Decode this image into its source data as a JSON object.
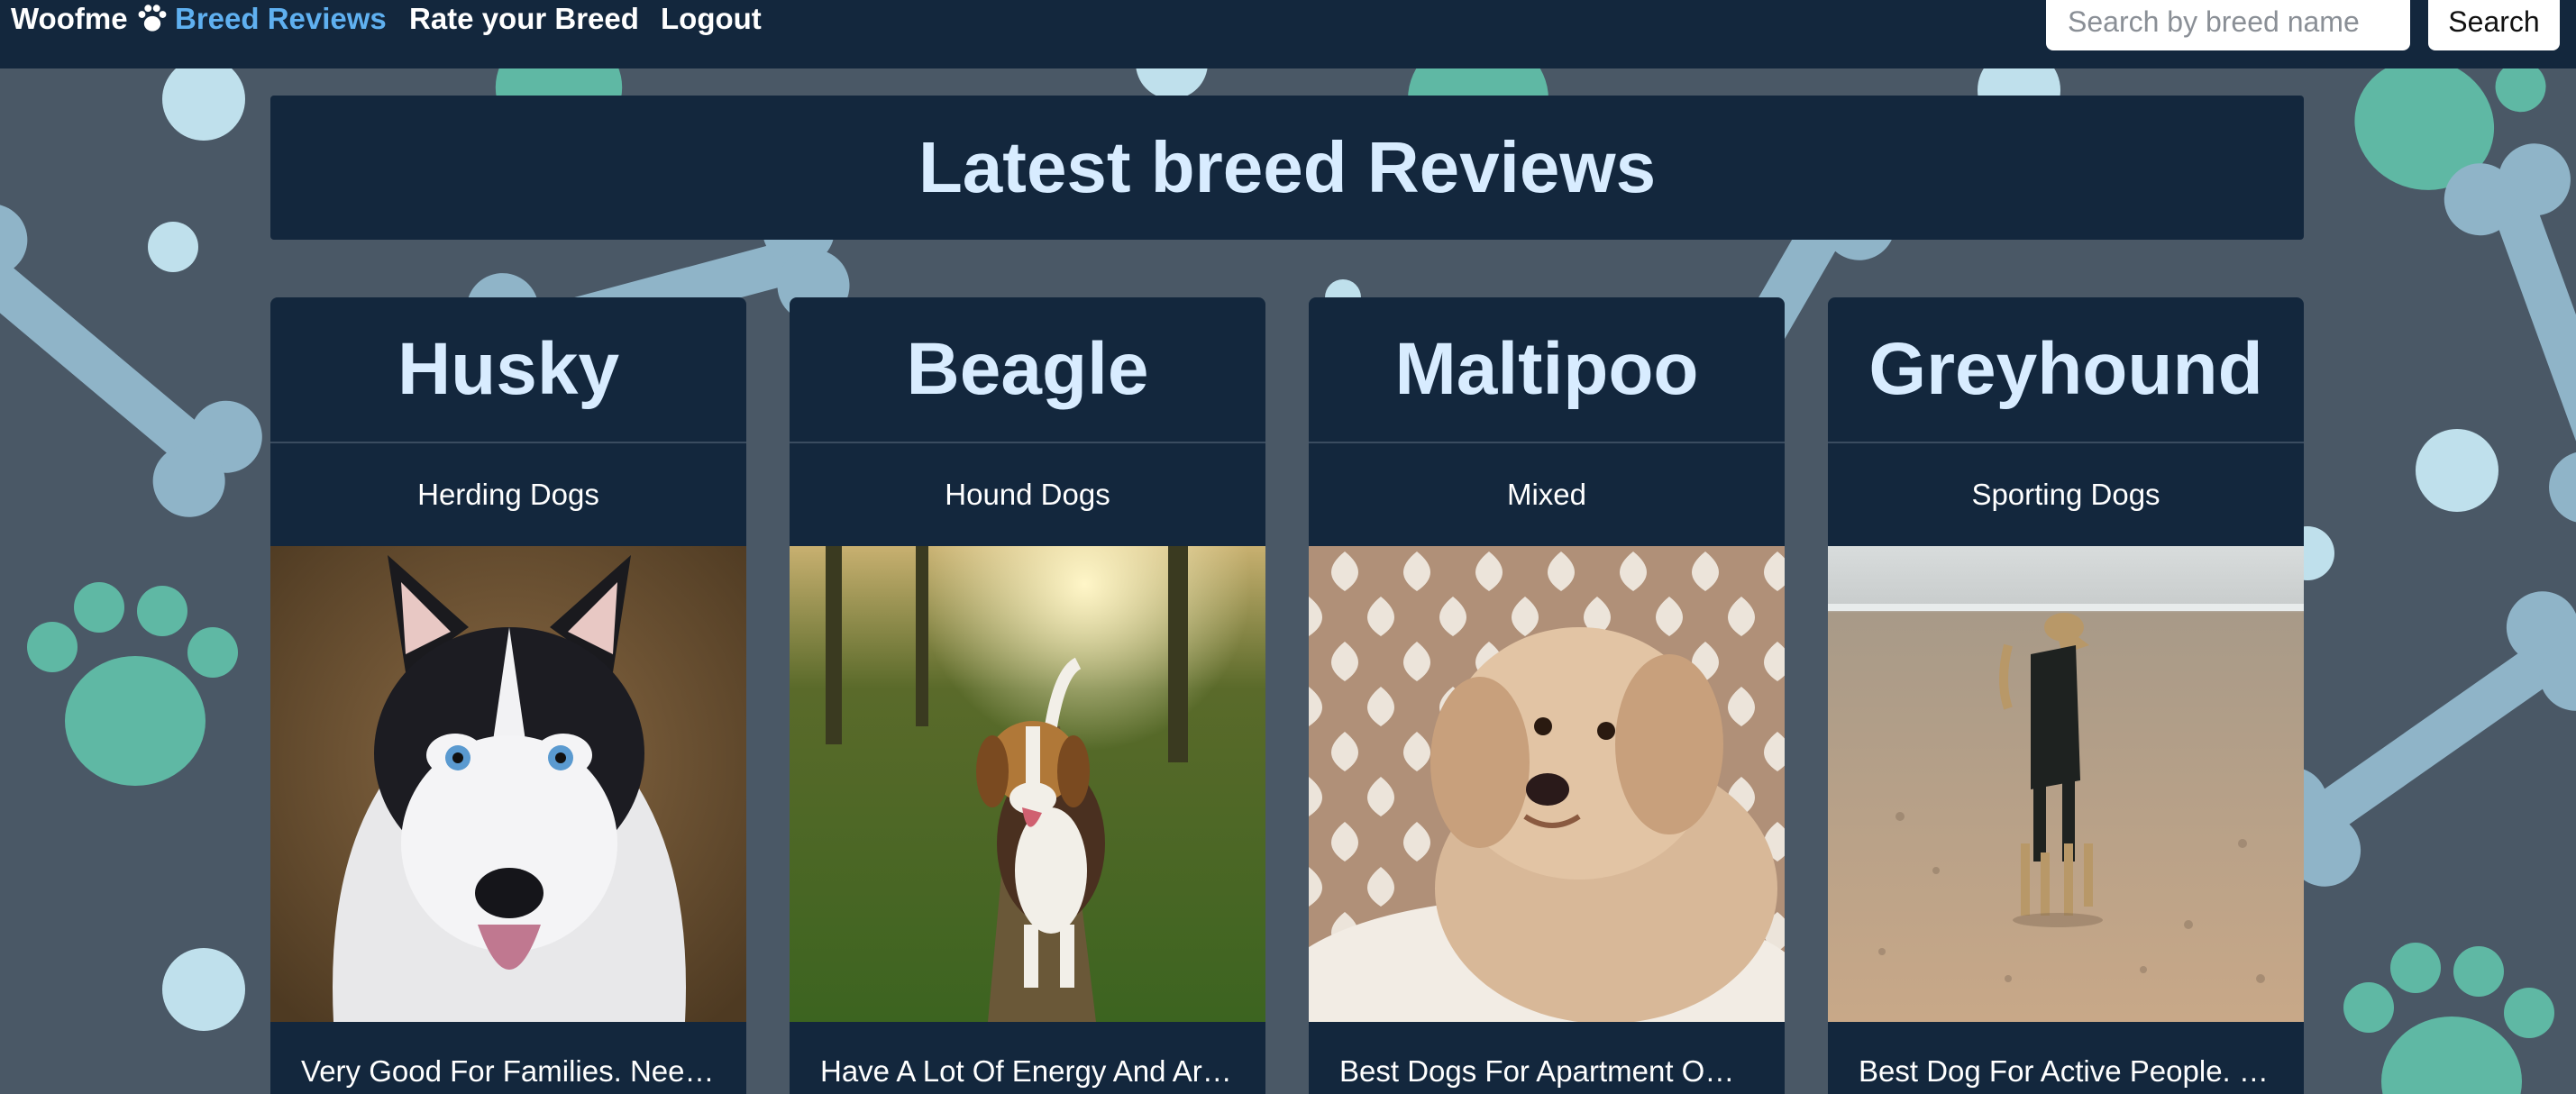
{
  "navbar": {
    "brand": "Woofme",
    "brand_icon": "paw-icon",
    "links": [
      {
        "label": "Breed Reviews",
        "active": true
      },
      {
        "label": "Rate your Breed",
        "active": false
      },
      {
        "label": "Logout",
        "active": false
      }
    ],
    "search": {
      "placeholder": "Search by breed name",
      "value": "",
      "button_label": "Search"
    }
  },
  "header": {
    "title": "Latest breed Reviews"
  },
  "cards": [
    {
      "name": "Husky",
      "group": "Herding Dogs",
      "description": "Very Good For Families. Need…"
    },
    {
      "name": "Beagle",
      "group": "Hound Dogs",
      "description": "Have A Lot Of Energy And Ar…"
    },
    {
      "name": "Maltipoo",
      "group": "Mixed",
      "description": "Best Dogs For Apartment Ow…"
    },
    {
      "name": "Greyhound",
      "group": "Sporting Dogs",
      "description": "Best Dog For Active People. …"
    }
  ],
  "colors": {
    "navbar": "#13273d",
    "background": "#4a5866",
    "active_link": "#5fb0f0",
    "title_text": "#d8ecff",
    "paw_green": "#5fb8a4",
    "bone_blue": "#8fb4c8"
  }
}
